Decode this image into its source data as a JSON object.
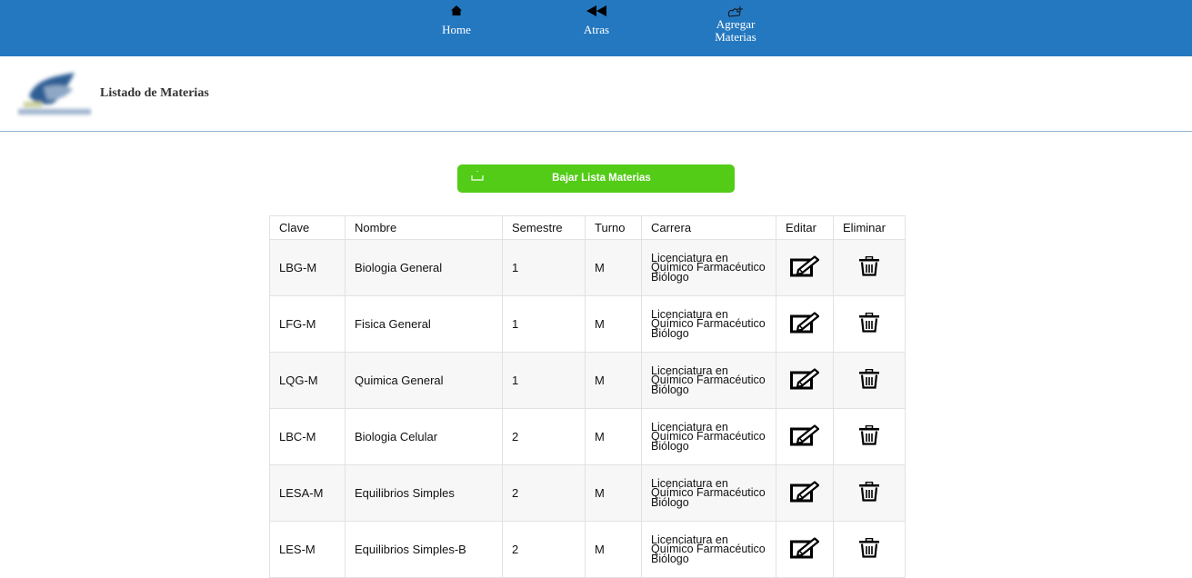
{
  "nav": {
    "home": "Home",
    "back": "Atras",
    "add_line1": "Agregar",
    "add_line2": "Materias"
  },
  "header": {
    "title": "Listado de Materias"
  },
  "download_button": {
    "label": "Bajar Lista Materias"
  },
  "table": {
    "headers": [
      "Clave",
      "Nombre",
      "Semestre",
      "Turno",
      "Carrera",
      "Editar",
      "Eliminar"
    ],
    "rows": [
      {
        "clave": "LBG-M",
        "nombre": "Biologia General",
        "semestre": "1",
        "turno": "M",
        "carrera": "Licenciatura en Químico Farmacéutico Biólogo"
      },
      {
        "clave": "LFG-M",
        "nombre": "Fisica General",
        "semestre": "1",
        "turno": "M",
        "carrera": "Licenciatura en Químico Farmacéutico Biólogo"
      },
      {
        "clave": "LQG-M",
        "nombre": "Quimica General",
        "semestre": "1",
        "turno": "M",
        "carrera": "Licenciatura en Químico Farmacéutico Biólogo"
      },
      {
        "clave": "LBC-M",
        "nombre": "Biologia Celular",
        "semestre": "2",
        "turno": "M",
        "carrera": "Licenciatura en Químico Farmacéutico Biólogo"
      },
      {
        "clave": "LESA-M",
        "nombre": "Equilibrios Simples",
        "semestre": "2",
        "turno": "M",
        "carrera": "Licenciatura en Químico Farmacéutico Biólogo"
      },
      {
        "clave": "LES-M",
        "nombre": "Equilibrios Simples-B",
        "semestre": "2",
        "turno": "M",
        "carrera": "Licenciatura en Químico Farmacéutico Biólogo"
      }
    ]
  },
  "icons": {
    "edit": "edit-icon",
    "delete": "trash-icon",
    "home": "home-icon",
    "back": "rewind-icon",
    "add": "add-subject-icon",
    "download": "download-icon"
  },
  "colors": {
    "topbar": "#2478c0",
    "download_button": "#52cc17"
  }
}
